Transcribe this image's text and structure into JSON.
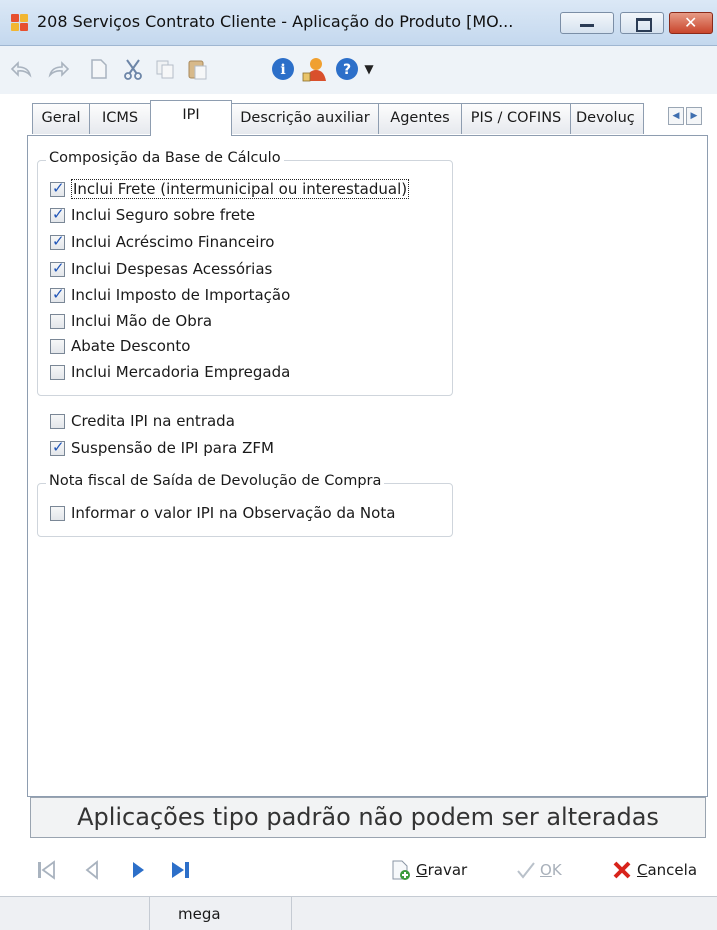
{
  "window": {
    "title": "208 Serviços Contrato Cliente - Aplicação do Produto [MO..."
  },
  "tabs": [
    {
      "label": "Geral"
    },
    {
      "label": "ICMS"
    },
    {
      "label": "IPI",
      "active": true
    },
    {
      "label": "Descrição auxiliar"
    },
    {
      "label": "Agentes"
    },
    {
      "label": "PIS / COFINS"
    },
    {
      "label": "Devoluç"
    }
  ],
  "base_calculo": {
    "legend": "Composição da Base de Cálculo",
    "options": [
      {
        "label": "Inclui Frete (intermunicipal ou interestadual)",
        "checked": true
      },
      {
        "label": "Inclui Seguro sobre frete",
        "checked": true
      },
      {
        "label": "Inclui Acréscimo Financeiro",
        "checked": true
      },
      {
        "label": "Inclui Despesas Acessórias",
        "checked": true
      },
      {
        "label": "Inclui Imposto de Importação",
        "checked": true
      },
      {
        "label": "Inclui Mão de Obra",
        "checked": false
      },
      {
        "label": "Abate Desconto",
        "checked": false
      },
      {
        "label": "Inclui Mercadoria Empregada",
        "checked": false
      }
    ]
  },
  "other_options": [
    {
      "label": "Credita IPI na entrada",
      "checked": false
    },
    {
      "label": "Suspensão de IPI para ZFM",
      "checked": true
    }
  ],
  "devolucao": {
    "legend": "Nota fiscal de Saída de Devolução de Compra",
    "options": [
      {
        "label": "Informar o valor IPI na Observação da Nota",
        "checked": false
      }
    ]
  },
  "status_message": "Aplicações tipo padrão não podem ser alteradas",
  "actions": {
    "save": {
      "mnemonic": "G",
      "rest": "ravar"
    },
    "ok": {
      "mnemonic": "O",
      "rest": "K"
    },
    "cancel": {
      "mnemonic": "C",
      "rest": "ancela"
    }
  },
  "statusbar": {
    "user": "mega"
  },
  "colors": {
    "accent_blue": "#2c6fc9",
    "cancel_red": "#d8231b",
    "save_green": "#3a9b3a"
  }
}
